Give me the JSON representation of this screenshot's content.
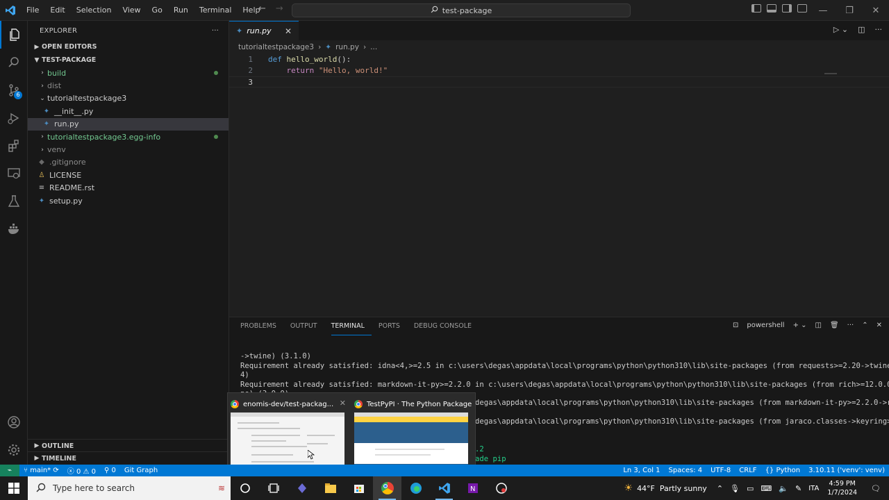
{
  "titlebar": {
    "menu": [
      "File",
      "Edit",
      "Selection",
      "View",
      "Go",
      "Run",
      "Terminal",
      "Help"
    ],
    "command_center": "test-package",
    "win_min": "—",
    "win_max": "❐",
    "win_close": "✕"
  },
  "activity": {
    "scm_badge": "6"
  },
  "explorer": {
    "title": "EXPLORER",
    "more": "···",
    "open_editors": "OPEN EDITORS",
    "project": "TEST-PACKAGE",
    "items": [
      {
        "label": "build"
      },
      {
        "label": "dist"
      },
      {
        "label": "tutorialtestpackage3"
      },
      {
        "label": "__init__.py"
      },
      {
        "label": "run.py"
      },
      {
        "label": "tutorialtestpackage3.egg-info"
      },
      {
        "label": "venv"
      },
      {
        "label": ".gitignore"
      },
      {
        "label": "LICENSE"
      },
      {
        "label": "README.rst"
      },
      {
        "label": "setup.py"
      }
    ],
    "outline": "OUTLINE",
    "timeline": "TIMELINE"
  },
  "editor": {
    "tab_label": "run.py",
    "breadcrumb": [
      "tutorialtestpackage3",
      "run.py",
      "..."
    ],
    "lines": [
      "1",
      "2",
      "3"
    ],
    "code": {
      "kw_def": "def",
      "fn_name": "hello_world",
      "sig_rest": "():",
      "kw_return": "return",
      "str_val": "\"Hello, world!\""
    }
  },
  "panel": {
    "tabs": [
      "PROBLEMS",
      "OUTPUT",
      "TERMINAL",
      "PORTS",
      "DEBUG CONSOLE"
    ],
    "shell": "powershell",
    "terminal_lines": [
      "->twine) (3.1.0)",
      "Requirement already satisfied: idna<4,>=2.5 in c:\\users\\degas\\appdata\\local\\programs\\python\\python310\\lib\\site-packages (from requests>=2.20->twine) (3.",
      "4)",
      "Requirement already satisfied: markdown-it-py>=2.2.0 in c:\\users\\degas\\appdata\\local\\programs\\python\\python310\\lib\\site-packages (from rich>=12.0.0->twi",
      "ne) (3.0.0)",
      "                                                    \\degas\\appdata\\local\\programs\\python\\python310\\lib\\site-packages (from markdown-it-py>=2.2.0->rich>",
      "",
      "                                                    \\degas\\appdata\\local\\programs\\python\\python310\\lib\\site-packages (from jaraco.classes->keyring>",
      "",
      "",
      "                                                    3.2",
      "                                                    rade pip"
    ]
  },
  "thumbnails": [
    {
      "title": "enomis-dev/test-packag..."
    },
    {
      "title": "TestPyPI · The Python Package In..."
    }
  ],
  "statusbar": {
    "branch": "main*",
    "errors": "0",
    "warnings": "0",
    "ports": "0",
    "git_graph": "Git Graph",
    "position": "Ln 3, Col 1",
    "spaces": "Spaces: 4",
    "encoding": "UTF-8",
    "eol": "CRLF",
    "language": "Python",
    "interpreter": "3.10.11 ('venv': venv)"
  },
  "taskbar": {
    "search_placeholder": "Type here to search",
    "weather": "44°F  Partly sunny",
    "lang": "ITA",
    "time": "4:59 PM",
    "date": "1/7/2024"
  },
  "colors": {
    "accent": "#0078d4",
    "git_added": "#73c991",
    "remote": "#16825d"
  }
}
